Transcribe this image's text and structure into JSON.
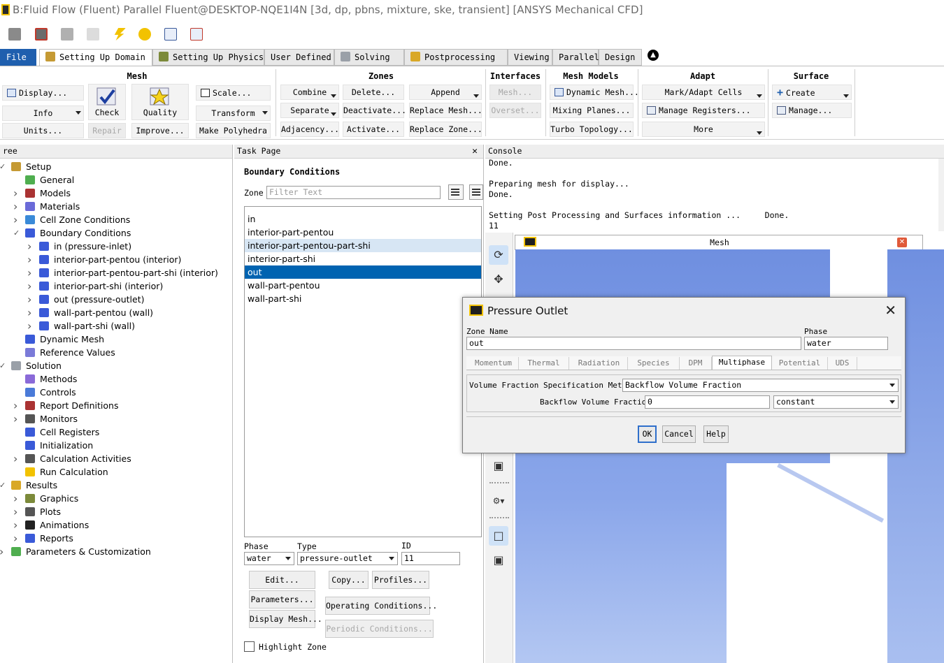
{
  "window": {
    "title": "B:Fluid Flow (Fluent) Parallel Fluent@DESKTOP-NQE1I4N  [3d, dp, pbns, mixture, ske, transient] [ANSYS Mechanical CFD]"
  },
  "tabs": {
    "file": "File",
    "setting_up_domain": "Setting Up Domain",
    "setting_up_physics": "Setting Up Physics",
    "user_defined": "User Defined",
    "solving": "Solving",
    "postprocessing": "Postprocessing",
    "viewing": "Viewing",
    "parallel": "Parallel",
    "design": "Design"
  },
  "ribbon": {
    "mesh": {
      "title": "Mesh",
      "display": "Display...",
      "check": "Check",
      "quality": "Quality",
      "scale": "Scale...",
      "info": "Info",
      "transform": "Transform",
      "units": "Units...",
      "repair": "Repair",
      "improve": "Improve...",
      "make_polyhedra": "Make Polyhedra"
    },
    "zones": {
      "title": "Zones",
      "combine": "Combine",
      "delete": "Delete...",
      "append": "Append",
      "separate": "Separate",
      "deactivate": "Deactivate...",
      "replace_mesh": "Replace Mesh...",
      "adjacency": "Adjacency...",
      "activate": "Activate...",
      "replace_zone": "Replace Zone..."
    },
    "interfaces": {
      "title": "Interfaces",
      "mesh": "Mesh...",
      "overset": "Overset..."
    },
    "mesh_models": {
      "title": "Mesh Models",
      "dynamic_mesh": "Dynamic Mesh...",
      "mixing_planes": "Mixing Planes...",
      "turbo_topology": "Turbo Topology..."
    },
    "adapt": {
      "title": "Adapt",
      "mark_adapt_cells": "Mark/Adapt Cells",
      "manage_registers": "Manage Registers...",
      "more": "More"
    },
    "surface": {
      "title": "Surface",
      "create": "Create",
      "manage": "Manage..."
    }
  },
  "tree": {
    "header": "ree",
    "items": [
      {
        "label": "Setup"
      },
      {
        "label": "General"
      },
      {
        "label": "Models"
      },
      {
        "label": "Materials"
      },
      {
        "label": "Cell Zone Conditions"
      },
      {
        "label": "Boundary Conditions"
      },
      {
        "label": "in (pressure-inlet)"
      },
      {
        "label": "interior-part-pentou (interior)"
      },
      {
        "label": "interior-part-pentou-part-shi (interior)"
      },
      {
        "label": "interior-part-shi (interior)"
      },
      {
        "label": "out (pressure-outlet)"
      },
      {
        "label": "wall-part-pentou (wall)"
      },
      {
        "label": "wall-part-shi (wall)"
      },
      {
        "label": "Dynamic Mesh"
      },
      {
        "label": "Reference Values"
      },
      {
        "label": "Solution"
      },
      {
        "label": "Methods"
      },
      {
        "label": "Controls"
      },
      {
        "label": "Report Definitions"
      },
      {
        "label": "Monitors"
      },
      {
        "label": "Cell Registers"
      },
      {
        "label": "Initialization"
      },
      {
        "label": "Calculation Activities"
      },
      {
        "label": "Run Calculation"
      },
      {
        "label": "Results"
      },
      {
        "label": "Graphics"
      },
      {
        "label": "Plots"
      },
      {
        "label": "Animations"
      },
      {
        "label": "Reports"
      },
      {
        "label": "Parameters & Customization"
      }
    ]
  },
  "task_page": {
    "header": "Task Page",
    "title": "Boundary Conditions",
    "zone_label": "Zone",
    "filter_placeholder": "Filter Text",
    "zones": [
      "in",
      "interior-part-pentou",
      "interior-part-pentou-part-shi",
      "interior-part-shi",
      "out",
      "wall-part-pentou",
      "wall-part-shi"
    ],
    "phase_label": "Phase",
    "phase_value": "water",
    "type_label": "Type",
    "type_value": "pressure-outlet",
    "id_label": "ID",
    "id_value": "11",
    "edit": "Edit...",
    "copy": "Copy...",
    "profiles": "Profiles...",
    "parameters": "Parameters...",
    "operating_conditions": "Operating Conditions...",
    "display_mesh": "Display Mesh...",
    "periodic_conditions": "Periodic Conditions...",
    "highlight_zone": "Highlight Zone"
  },
  "console": {
    "header": "Console",
    "text": "Done.\n\nPreparing mesh for display...\nDone.\n\nSetting Post Processing and Surfaces information ...     Done.\n11"
  },
  "graphics": {
    "tab_title": "Mesh"
  },
  "dialog": {
    "title": "Pressure Outlet",
    "zone_name_label": "Zone Name",
    "zone_name_value": "out",
    "phase_label": "Phase",
    "phase_value": "water",
    "tabs": [
      "Momentum",
      "Thermal",
      "Radiation",
      "Species",
      "DPM",
      "Multiphase",
      "Potential",
      "UDS"
    ],
    "vf_method_label": "Volume Fraction Specification Method",
    "vf_method_value": "Backflow Volume Fraction",
    "backflow_label": "Backflow Volume Fraction",
    "backflow_value": "0",
    "backflow_method": "constant",
    "ok": "OK",
    "cancel": "Cancel",
    "help": "Help"
  },
  "colors": {
    "accent": "#0063b1",
    "file_tab": "#1f5fae",
    "mesh_blue": "#7290e0"
  }
}
